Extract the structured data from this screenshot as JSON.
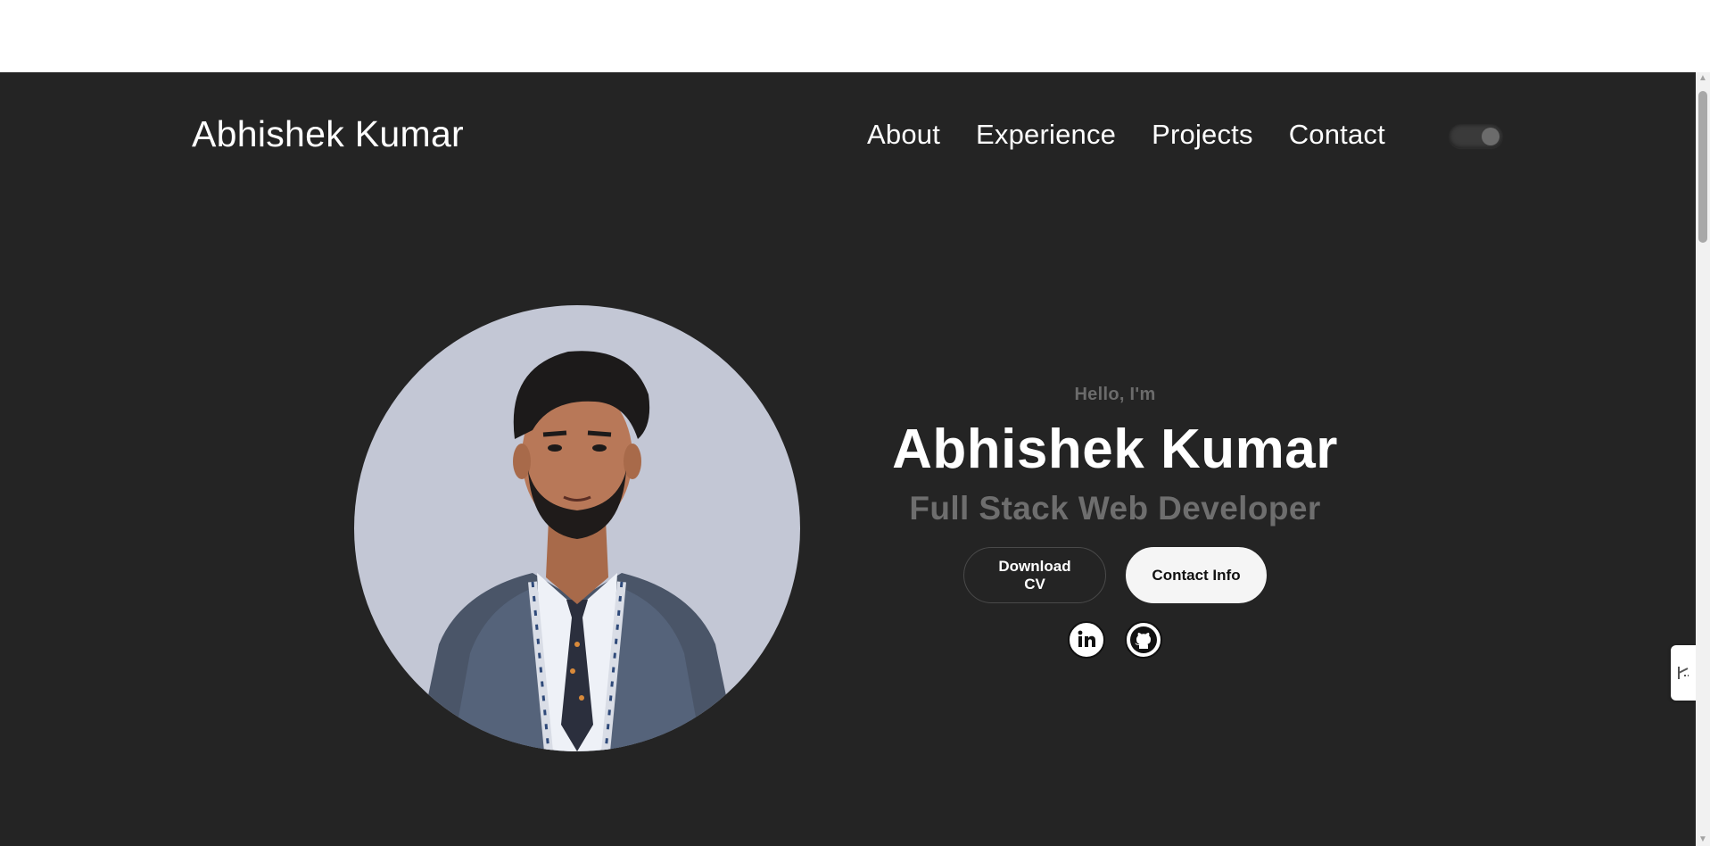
{
  "brand": "Abhishek Kumar",
  "nav": {
    "items": [
      "About",
      "Experience",
      "Projects",
      "Contact"
    ]
  },
  "theme_toggle": {
    "icon": "theme-toggle-icon",
    "state": "on"
  },
  "hero": {
    "greeting": "Hello, I'm",
    "name": "Abhishek Kumar",
    "role": "Full Stack Web Developer",
    "buttons": {
      "download_cv": "Download CV",
      "contact_info": "Contact Info"
    },
    "social": [
      {
        "icon": "linkedin-icon"
      },
      {
        "icon": "github-icon"
      }
    ]
  },
  "colors": {
    "page_bg": "#242424",
    "text_primary": "#ffffff",
    "text_muted": "#6e6e6e",
    "photo_bg": "#c3c7d5"
  }
}
